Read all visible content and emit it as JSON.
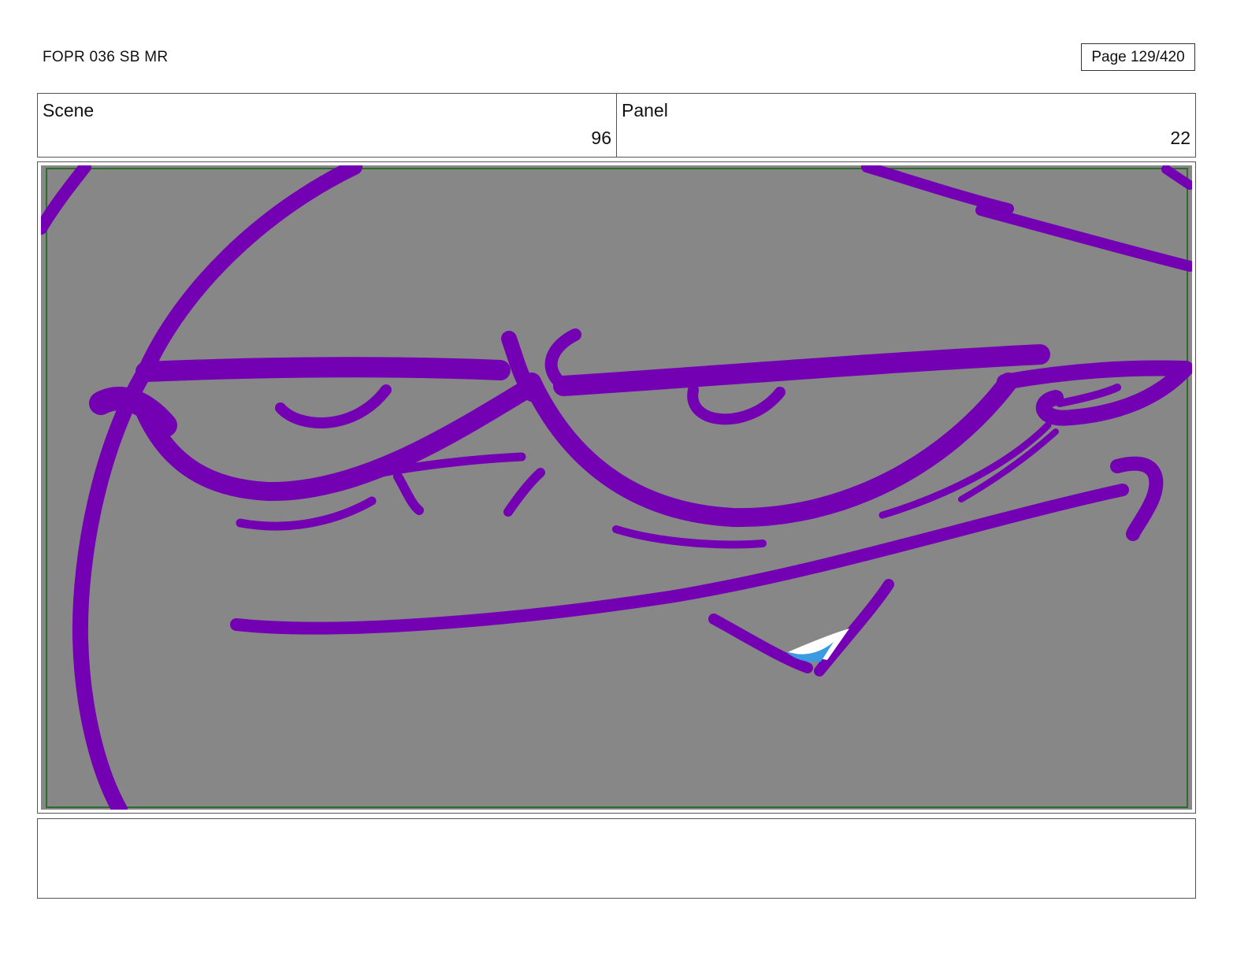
{
  "header": {
    "title": "FOPR 036 SB MR",
    "page_label": "Page 129/420"
  },
  "info": {
    "scene_label": "Scene",
    "scene_value": "96",
    "panel_label": "Panel",
    "panel_value": "22"
  },
  "artwork": {
    "background_color": "#878787",
    "line_color": "#7400b4",
    "safe_frame_color": "#2e6b2e",
    "highlight_color": "#3a9be0"
  },
  "notes": {
    "text": ""
  }
}
